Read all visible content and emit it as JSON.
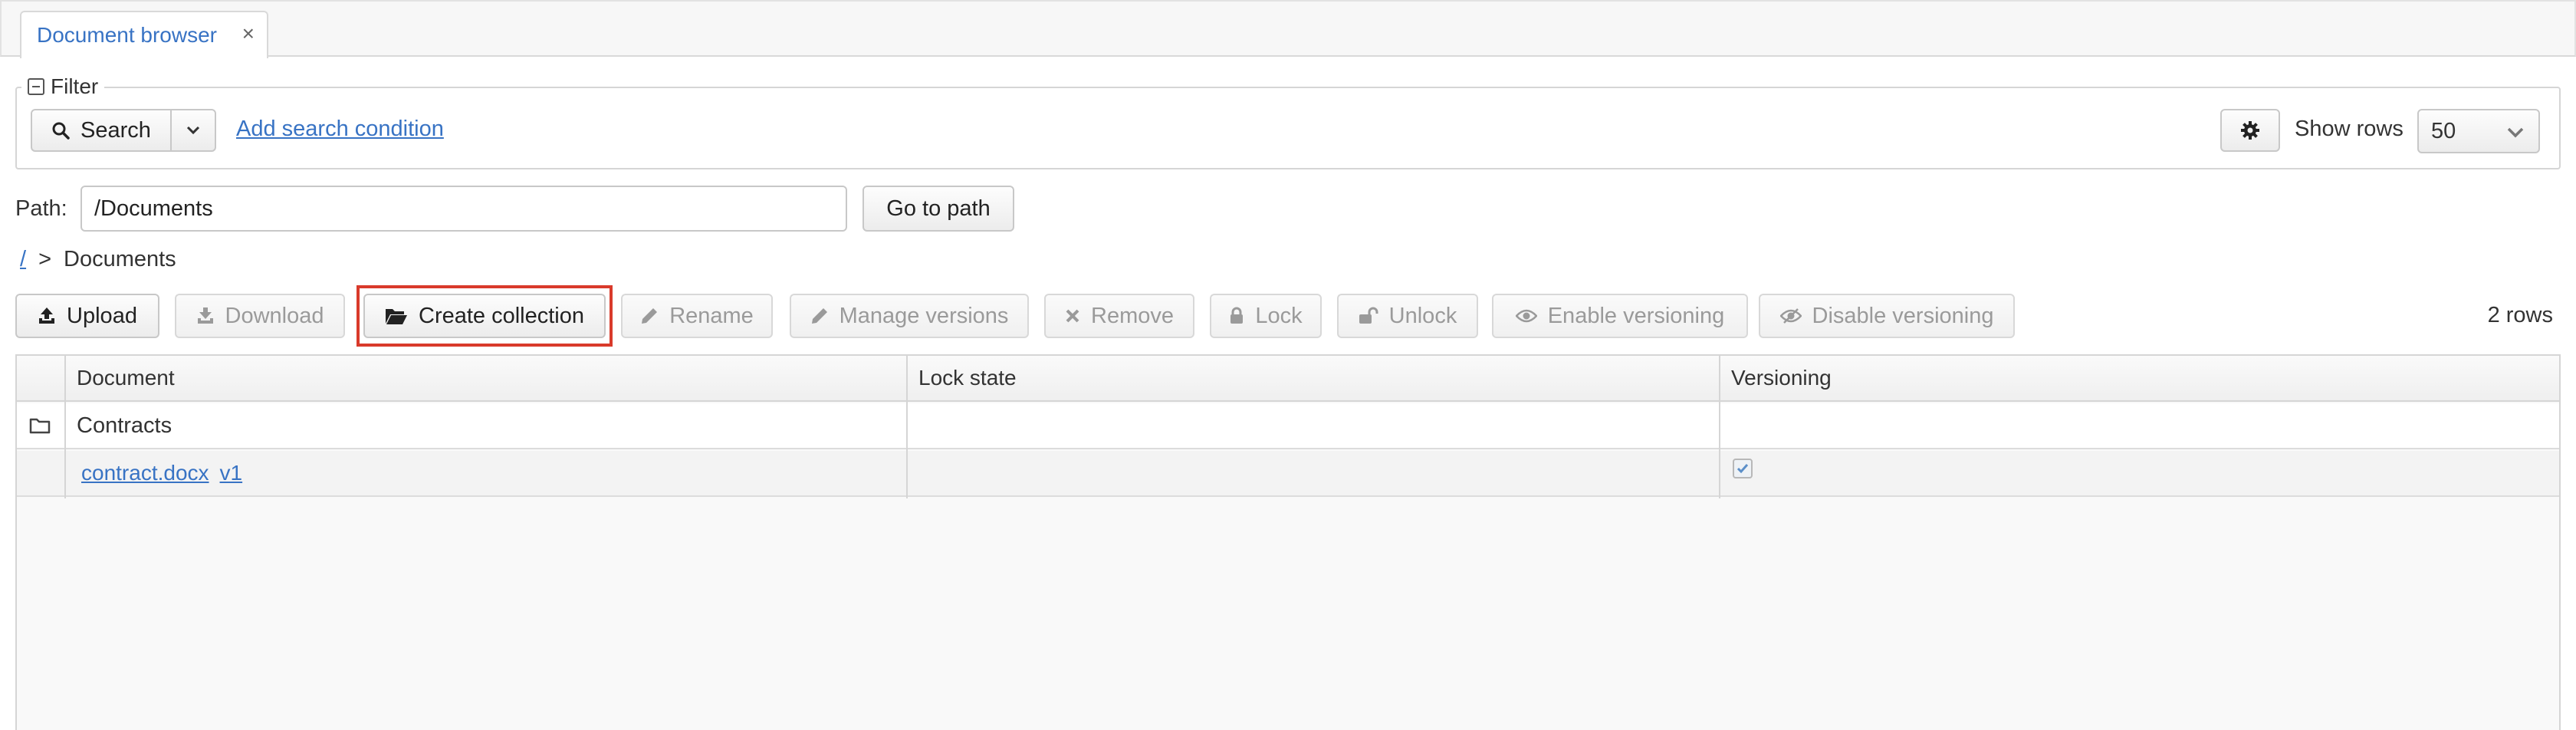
{
  "tabs": [
    {
      "label": "Document browser",
      "close_glyph": "×"
    }
  ],
  "filter": {
    "legend": "Filter",
    "search_label": "Search",
    "add_condition": "Add search condition",
    "show_rows_label": "Show rows",
    "show_rows_value": "50"
  },
  "path": {
    "label": "Path:",
    "value": "/Documents",
    "go_label": "Go to path"
  },
  "breadcrumb": {
    "root": "/",
    "separator": ">",
    "current": "Documents"
  },
  "toolbar": {
    "upload": "Upload",
    "download": "Download",
    "create_collection": "Create collection",
    "rename": "Rename",
    "manage_versions": "Manage versions",
    "remove": "Remove",
    "lock": "Lock",
    "unlock": "Unlock",
    "enable_versioning": "Enable versioning",
    "disable_versioning": "Disable versioning",
    "row_count": "2 rows"
  },
  "table": {
    "columns": [
      "Document",
      "Lock state",
      "Versioning"
    ],
    "rows": [
      {
        "type": "folder",
        "document": "Contracts",
        "lock_state": "",
        "versioning": false
      },
      {
        "type": "file",
        "document": "contract.docx",
        "version": "v1",
        "lock_state": "",
        "versioning": true
      }
    ]
  },
  "colors": {
    "accent": "#3873c4",
    "highlight": "#d93a2b"
  },
  "icons": {
    "search": "search-icon",
    "dropdown": "chevron-down-icon",
    "settings": "gear-icon",
    "upload": "upload-icon",
    "download": "download-icon",
    "create_collection": "folder-open-icon",
    "rename": "pencil-icon",
    "manage_versions": "pencil-icon",
    "remove": "times-icon",
    "lock": "lock-icon",
    "unlock": "unlock-icon",
    "enable_versioning": "eye-icon",
    "disable_versioning": "eye-slash-icon",
    "folder": "folder-icon",
    "checked": "check-icon"
  }
}
